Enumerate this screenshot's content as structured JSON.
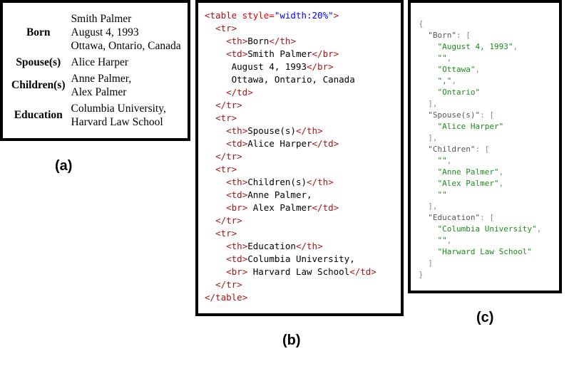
{
  "panel_a": {
    "caption": "(a)",
    "rows": [
      {
        "header": "Born",
        "lines": [
          "Smith Palmer",
          "August 4, 1993",
          "Ottawa, Ontario, Canada"
        ]
      },
      {
        "header": "Spouse(s)",
        "lines": [
          "Alice Harper"
        ]
      },
      {
        "header": "Children(s)",
        "lines": [
          "Anne Palmer,",
          "Alex Palmer"
        ]
      },
      {
        "header": "Education",
        "lines": [
          "Columbia University,",
          "Harvard Law School"
        ]
      }
    ]
  },
  "panel_b": {
    "caption": "(b)",
    "code_lines": [
      "<table style=\"width:20%\">",
      "  <tr>",
      "    <th>Born</th>",
      "    <td>Smith Palmer</br>",
      "     August 4, 1993</br>",
      "     Ottawa, Ontario, Canada",
      "    </td>",
      "  </tr>",
      "  <tr>",
      "    <th>Spouse(s)</th>",
      "    <td>Alice Harper</td>",
      "  </tr>",
      "  <tr>",
      "    <th>Children(s)</th>",
      "    <td>Anne Palmer,",
      "    <br> Alex Palmer</td>",
      "  </tr>",
      "  <tr>",
      "    <th>Education</th>",
      "    <td>Columbia University,",
      "    <br> Harvard Law School</td>",
      "  </tr>",
      "</table>"
    ]
  },
  "panel_c": {
    "caption": "(c)",
    "json": {
      "Born": [
        "August 4, 1993",
        "",
        "Ottawa",
        ",",
        "Ontario"
      ],
      "Spouse(s)": [
        "Alice Harper"
      ],
      "Children": [
        "",
        "Anne Palmer",
        "Alex Palmer",
        ""
      ],
      "Education": [
        "Columbia University",
        "",
        "Harward Law School"
      ]
    }
  }
}
